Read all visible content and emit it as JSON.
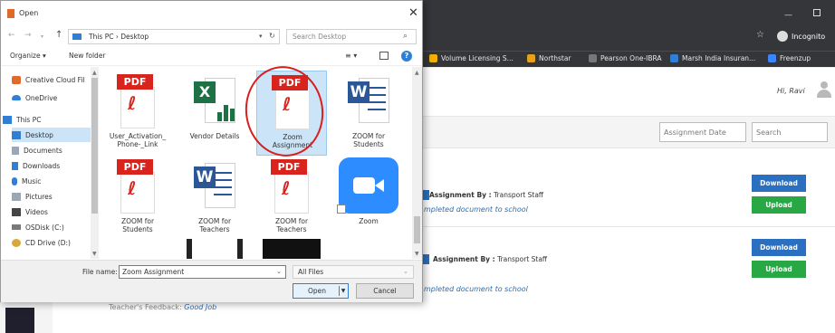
{
  "browser": {
    "incognito_label": "Incognito",
    "bookmarks": [
      {
        "label": "Volume Licensing S...",
        "color": "#f2b100"
      },
      {
        "label": "Northstar",
        "color": "#e5a21a"
      },
      {
        "label": "Pearson One-IBRA",
        "color": "#777777"
      },
      {
        "label": "Marsh India Insuran...",
        "color": "#2f7fd6"
      },
      {
        "label": "Freenzup",
        "color": "#3a86ff"
      }
    ],
    "user_greeting": "Hi, Ravi",
    "filters": {
      "assignment_date_placeholder": "Assignment Date",
      "search_placeholder": "Search"
    },
    "rows": [
      {
        "assignment_by_label": "Assignment By :",
        "assignment_by_value": "Transport Staff",
        "instruction": "mpleted document to school",
        "download": "Download",
        "upload": "Upload"
      },
      {
        "assignment_by_label": "Assignment By :",
        "assignment_by_value": "Transport Staff",
        "instruction": "mpleted document to school",
        "download": "Download",
        "upload": "Upload"
      }
    ],
    "feedback_label": "Teacher's Feedback:",
    "feedback_value": "Good Job"
  },
  "dialog": {
    "title": "Open",
    "address": "This PC  ›  Desktop",
    "search_placeholder": "Search Desktop",
    "organize": "Organize ▾",
    "new_folder": "New folder",
    "nav_items": [
      {
        "label": "Creative Cloud Fil",
        "icon": "cloud-icon",
        "color": "#e06a2a"
      },
      {
        "label": "OneDrive",
        "icon": "onedrive-icon",
        "color": "#2f7fd6"
      },
      {
        "label": "This PC",
        "icon": "pc-icon",
        "color": "#2f7fd6"
      },
      {
        "label": "Desktop",
        "icon": "desktop-icon",
        "color": "#2f7fd6",
        "selected": true
      },
      {
        "label": "Documents",
        "icon": "documents-icon",
        "color": "#9aa7b8"
      },
      {
        "label": "Downloads",
        "icon": "downloads-icon",
        "color": "#2f7fd6"
      },
      {
        "label": "Music",
        "icon": "music-icon",
        "color": "#2f7fd6"
      },
      {
        "label": "Pictures",
        "icon": "pictures-icon",
        "color": "#9aa7b8"
      },
      {
        "label": "Videos",
        "icon": "videos-icon",
        "color": "#444444"
      },
      {
        "label": "OSDisk (C:)",
        "icon": "disk-icon",
        "color": "#7a7a7a"
      },
      {
        "label": "CD Drive (D:)",
        "icon": "cd-icon",
        "color": "#d7a93a"
      }
    ],
    "files": [
      {
        "name": "User_Activation_\nPhone-_Link",
        "type": "pdf"
      },
      {
        "name": "Vendor Details",
        "type": "excel"
      },
      {
        "name": "Zoom\nAssignment",
        "type": "pdf",
        "selected": true
      },
      {
        "name": "ZOOM for\nStudents",
        "type": "word"
      },
      {
        "name": "ZOOM for\nStudents",
        "type": "pdf"
      },
      {
        "name": "ZOOM for\nTeachers",
        "type": "word"
      },
      {
        "name": "ZOOM for\nTeachers",
        "type": "pdf"
      },
      {
        "name": "Zoom",
        "type": "zoom"
      }
    ],
    "file_name_label": "File name:",
    "file_name_value": "Zoom Assignment",
    "file_type": "All Files",
    "open_label": "Open",
    "cancel_label": "Cancel"
  }
}
